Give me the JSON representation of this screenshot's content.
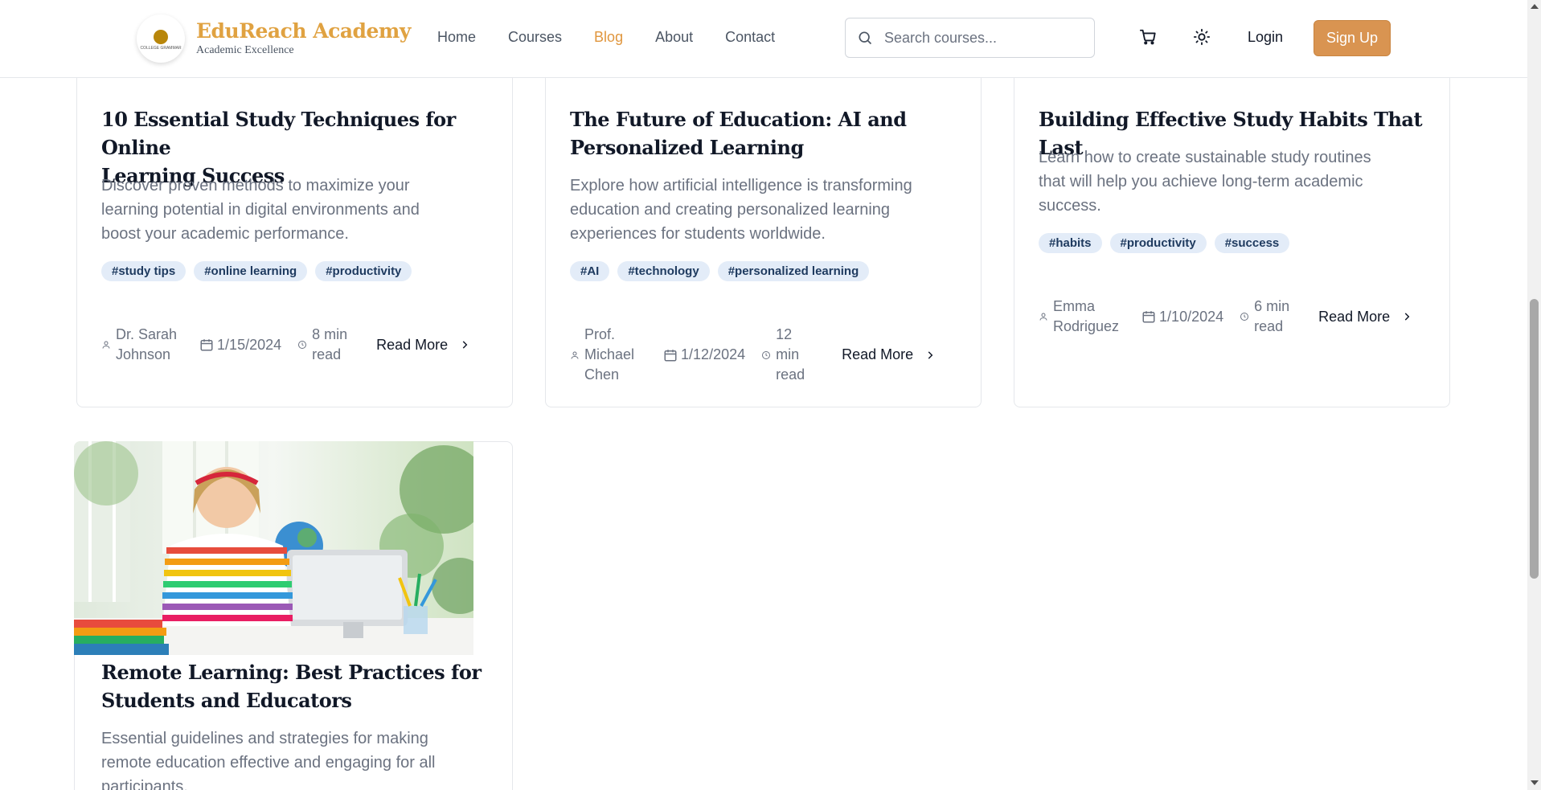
{
  "header": {
    "brand_title": "EduReach Academy",
    "brand_subtitle": "Academic Excellence",
    "logo_small_text": "COLLEGE GRAMMAR",
    "nav": [
      {
        "label": "Home"
      },
      {
        "label": "Courses"
      },
      {
        "label": "Blog",
        "active": true
      },
      {
        "label": "About"
      },
      {
        "label": "Contact"
      }
    ],
    "search_placeholder": "Search courses...",
    "login_label": "Login",
    "signup_label": "Sign Up",
    "accent_color": "#e0963e",
    "signup_color": "#d99451"
  },
  "posts": [
    {
      "title_line1": "10 Essential Study Techniques for Online",
      "title_line2": "Learning Success",
      "desc_line1": "Discover proven methods to maximize your",
      "desc_line2": "learning potential in digital environments and",
      "desc_line3": "boost your academic performance.",
      "tags": [
        "#study tips",
        "#online learning",
        "#productivity"
      ],
      "author_line1": "Dr. Sarah",
      "author_line2": "Johnson",
      "date": "1/15/2024",
      "read_line1": "8 min",
      "read_line2": "read",
      "read_more": "Read More"
    },
    {
      "title_line1": "The Future of Education: AI and",
      "title_line2": "Personalized Learning",
      "desc_line1": "Explore how artificial intelligence is transforming",
      "desc_line2": "education and creating personalized learning",
      "desc_line3": "experiences for students worldwide.",
      "tags": [
        "#AI",
        "#technology",
        "#personalized learning"
      ],
      "author_line1": "Prof.",
      "author_line2": "Michael",
      "author_line3": "Chen",
      "date": "1/12/2024",
      "read_line1": "12",
      "read_line2": "min",
      "read_line3": "read",
      "read_more": "Read More"
    },
    {
      "title_line1": "Building Effective Study Habits That Last",
      "desc_line1": "Learn how to create sustainable study routines",
      "desc_line2": "that will help you achieve long-term academic",
      "desc_line3": "success.",
      "tags": [
        "#habits",
        "#productivity",
        "#success"
      ],
      "author_line1": "Emma",
      "author_line2": "Rodriguez",
      "date": "1/10/2024",
      "read_line1": "6 min",
      "read_line2": "read",
      "read_more": "Read More"
    },
    {
      "title_line1": "Remote Learning: Best Practices for",
      "title_line2": "Students and Educators",
      "desc_line1": "Essential guidelines and strategies for making",
      "desc_line2": "remote education effective and engaging for all",
      "desc_line3": "participants."
    }
  ]
}
